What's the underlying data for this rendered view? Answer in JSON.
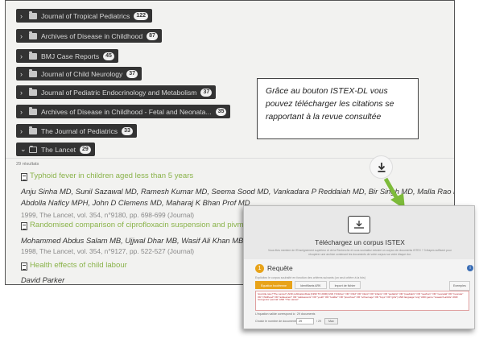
{
  "journals": [
    {
      "label": "Journal of Tropical Pediatrics",
      "count": "122",
      "expanded": false
    },
    {
      "label": "Archives of Disease in Childhood",
      "count": "87",
      "expanded": false
    },
    {
      "label": "BMJ Case Reports",
      "count": "45",
      "expanded": false
    },
    {
      "label": "Journal of Child Neurology",
      "count": "37",
      "expanded": false
    },
    {
      "label": "Journal of Pediatric Endocrinology and Metabolism",
      "count": "37",
      "expanded": false
    },
    {
      "label": "Archives of Disease in Childhood - Fetal and Neonata...",
      "count": "35",
      "expanded": false
    },
    {
      "label": "The Journal of Pediatrics",
      "count": "33",
      "expanded": false
    },
    {
      "label": "The Lancet",
      "count": "29",
      "expanded": true
    }
  ],
  "results_count": "29 résultats",
  "download_icon": "download-icon",
  "articles": [
    {
      "title": "Typhoid fever in children aged less than 5 years",
      "authors_line1": "Anju Sinha MD, Sunil Sazawal MD, Ramesh Kumar MD, Seema Sood MD, Vankadara P Reddaiah MD, Bir Singh MD, Malla Rao MPH,",
      "authors_line2": "Abdolla Naficy MPH, John D Clemens MD, Maharaj K Bhan Prof MD",
      "meta": "1999, The Lancet, vol. 354, n°9180, pp. 698-699 (Journal)"
    },
    {
      "title": "Randomised comparison of ciprofloxacin suspension and pivmecillinam for ch",
      "authors_line1": "Mohammed Abdus Salam MB, Ujjwal Dhar MB, Wasif Ali Khan MB, Michael L Benn",
      "authors_line2": "",
      "meta": "1998, The Lancet, vol. 354, n°9127, pp. 522-527 (Journal)"
    },
    {
      "title": "Health effects of child labour",
      "authors_line1": "David Parker",
      "authors_line2": "",
      "meta": ""
    }
  ],
  "callout": {
    "line1": "Grâce au bouton ISTEX-DL vous",
    "line2": "pouvez télécharger les citations se",
    "line3": "rapportant à la revue consultée"
  },
  "istex": {
    "title": "Téléchargez un corpus ISTEX",
    "subtitle": "Vous êtes membre de l'Enseignement supérieur et de la Recherche et vous souhaitez extraire un corpus de documents ISTEX ? 3 étapes suffisent pour récupérer une archive contenant les documents de votre corpus sur votre disque dur.",
    "step_number": "1",
    "step_label": "Requête",
    "help": "Explicitez le corpus souhaité en fonction des critères suivants (un seul critère à la fois)",
    "tabs": [
      "Équation booléenne",
      "Identifiants ARK",
      "Import de fichier"
    ],
    "examples_label": "Exemples",
    "query": "host.title.raw:(\"The Lancet\") AND publicationDate:[1990 TO 2000] AND (\"children\" OR \"child\" OR \"infant\" OR \"infants\" OR \"pediatric\" OR \"paediatric\" OR \"newborn\" OR \"neonatal\" OR \"neonate\" OR \"childhood\" OR \"adolescent\" OR \"adolescents\" OR \"youth\" OR \"toddler\" OR \"preschool\" OR \"school-age\" OR \"boys\" OR \"girls\") AND language:\"eng\" AND genre:\"research-article\" AND host.genre:\"journal\" AND \"The Lancet\"",
    "query_ok": "L'équation valide correspond à : 29 documents",
    "count_label": "Choisir le nombre de documents",
    "count_value": "29",
    "count_max": "/ 29",
    "count_button": "Max"
  }
}
